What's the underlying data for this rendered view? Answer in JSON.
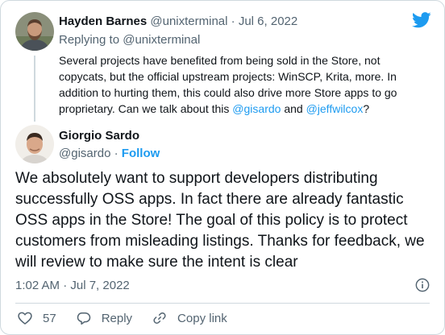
{
  "parent": {
    "name": "Hayden Barnes",
    "handle": "@unixterminal",
    "separator": " · ",
    "date": "Jul 6, 2022",
    "reply_prefix": "Replying to ",
    "reply_handle": "@unixterminal",
    "text_1": "Several projects have benefited from being sold in the Store, not copycats, but the official upstream projects: WinSCP, Krita, more. In addition to hurting them, this could also drive more Store apps to go proprietary. Can we talk about this ",
    "mention_1": "@gisardo",
    "text_and": " and ",
    "mention_2": "@jeffwilcox",
    "text_end": "?"
  },
  "author": {
    "name": "Giorgio Sardo",
    "handle": "@gisardo",
    "dot": " · ",
    "follow_label": "Follow"
  },
  "tweet": {
    "text": "We absolutely want to support developers distributing successfully OSS apps. In fact there are already fantastic OSS apps in the Store! The goal of this policy is to protect customers from misleading listings. Thanks for feedback, we will review to make sure the intent is clear",
    "timestamp": "1:02 AM · Jul 7, 2022"
  },
  "actions": {
    "like_count": "57",
    "reply_label": "Reply",
    "copy_label": "Copy link"
  },
  "colors": {
    "accent": "#1d9bf0",
    "muted": "#536471",
    "text": "#0f1419",
    "border": "#cfd9de"
  },
  "icons": [
    "twitter-bird-icon",
    "info-icon",
    "heart-icon",
    "reply-icon",
    "link-icon"
  ]
}
